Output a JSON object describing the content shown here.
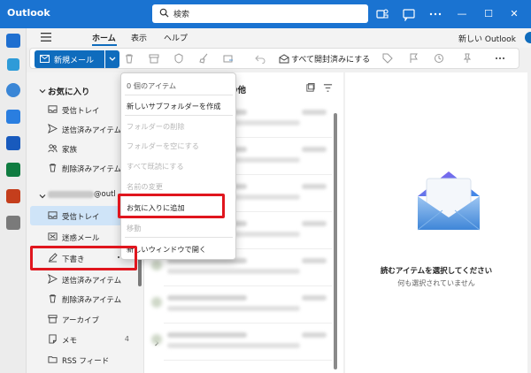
{
  "titlebar": {
    "app_title": "Outlook",
    "search_placeholder": "検索",
    "window_controls": [
      "minimize",
      "maximize",
      "close"
    ]
  },
  "ribbon": {
    "tabs": [
      {
        "label": "ホーム",
        "active": true
      },
      {
        "label": "表示",
        "active": false
      },
      {
        "label": "ヘルプ",
        "active": false
      }
    ],
    "new_outlook_label": "新しい Outlook",
    "new_outlook_enabled": true,
    "new_mail_label": "新規メール",
    "mark_all_read_label": "すべて開封済みにする"
  },
  "folder_pane": {
    "favorites_label": "お気に入り",
    "favorites": [
      {
        "label": "受信トレイ",
        "icon": "inbox-icon"
      },
      {
        "label": "送信済みアイテム",
        "icon": "send-icon"
      },
      {
        "label": "家族",
        "icon": "people-icon"
      },
      {
        "label": "削除済みアイテム",
        "icon": "trash-icon"
      }
    ],
    "account_suffix": "@outl",
    "account_folders": [
      {
        "label": "受信トレイ",
        "icon": "inbox-icon",
        "selected": true,
        "count": ""
      },
      {
        "label": "迷惑メール",
        "icon": "junk-icon",
        "selected": false,
        "count": ""
      },
      {
        "label": "下書き",
        "icon": "draft-icon",
        "selected": false,
        "count": ""
      },
      {
        "label": "送信済みアイテム",
        "icon": "send-icon",
        "selected": false,
        "count": ""
      },
      {
        "label": "削除済みアイテム",
        "icon": "trash-icon",
        "selected": false,
        "count": ""
      },
      {
        "label": "アーカイブ",
        "icon": "archive-icon",
        "selected": false,
        "count": ""
      },
      {
        "label": "メモ",
        "icon": "note-icon",
        "selected": false,
        "count": "4"
      },
      {
        "label": "RSS フィード",
        "icon": "folder-icon",
        "selected": false,
        "count": ""
      }
    ]
  },
  "message_list": {
    "tab_label": "の他"
  },
  "reading_pane": {
    "title": "読むアイテムを選択してください",
    "subtitle": "何も選択されていません"
  },
  "context_menu": {
    "items": [
      {
        "label": "0 個のアイテム",
        "state": "header"
      },
      {
        "label": "新しいサブフォルダーを作成",
        "state": "enabled"
      },
      {
        "label": "フォルダーの削除",
        "state": "disabled"
      },
      {
        "label": "フォルダーを空にする",
        "state": "disabled"
      },
      {
        "label": "すべて既読にする",
        "state": "disabled"
      },
      {
        "label": "名前の変更",
        "state": "disabled"
      },
      {
        "label": "お気に入りに追加",
        "state": "enabled"
      },
      {
        "label": "移動",
        "state": "disabled"
      },
      {
        "label": "新しいウィンドウで開く",
        "state": "enabled"
      }
    ]
  },
  "colors": {
    "brand": "#1a73d1",
    "accent": "#0f6cbd",
    "highlight": "#e0161e",
    "selected_folder": "#cfe4f8"
  }
}
